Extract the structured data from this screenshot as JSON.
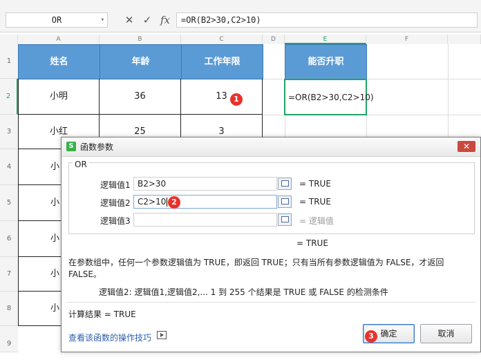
{
  "formula_bar": {
    "name_box": "OR",
    "formula": "=OR(B2>30,C2>10)",
    "icons": [
      "cancel-icon",
      "confirm-icon",
      "fx-icon"
    ],
    "cancel_glyph": "✕",
    "confirm_glyph": "✓",
    "fx_glyph": "fx"
  },
  "columns": [
    "A",
    "B",
    "C",
    "D",
    "E",
    "F"
  ],
  "rows": [
    "1",
    "2",
    "3",
    "4",
    "5",
    "6",
    "7",
    "8",
    "9"
  ],
  "table": {
    "headers": {
      "a": "姓名",
      "b": "年龄",
      "c": "工作年限",
      "e": "能否升职"
    },
    "row2": {
      "a": "小明",
      "b": "36",
      "c": "13",
      "e": "=OR(B2>30,C2>10)"
    },
    "row3": {
      "a": "小红",
      "b": "25",
      "c": "3"
    },
    "partial": [
      "小",
      "小",
      "小",
      "小",
      "小"
    ]
  },
  "badges": [
    "1",
    "2",
    "3"
  ],
  "dialog": {
    "title": "函数参数",
    "close_glyph": "✕",
    "function_name": "OR",
    "args": [
      {
        "label": "逻辑值1",
        "value": "B2>30",
        "result": "= TRUE"
      },
      {
        "label": "逻辑值2",
        "value": "C2>10",
        "result": "= TRUE"
      },
      {
        "label": "逻辑值3",
        "value": "",
        "result": "= 逻辑值"
      }
    ],
    "total_result": "= TRUE",
    "description": "在参数组中，任何一个参数逻辑值为 TRUE，即返回 TRUE；只有当所有参数逻辑值为 FALSE，才返回 FALSE。",
    "arg_description": "逻辑值2:   逻辑值1,逻辑值2,... 1 到 255 个结果是 TRUE 或 FALSE 的检测条件",
    "calc_result": "计算结果  =  TRUE",
    "help_link": "查看该函数的操作技巧",
    "ok_label": "确定",
    "cancel_label": "取消"
  },
  "colors": {
    "header_blue": "#5b9bd5",
    "badge_red": "#e8332b",
    "active_green": "#21a366",
    "link_blue": "#2a5db0"
  }
}
